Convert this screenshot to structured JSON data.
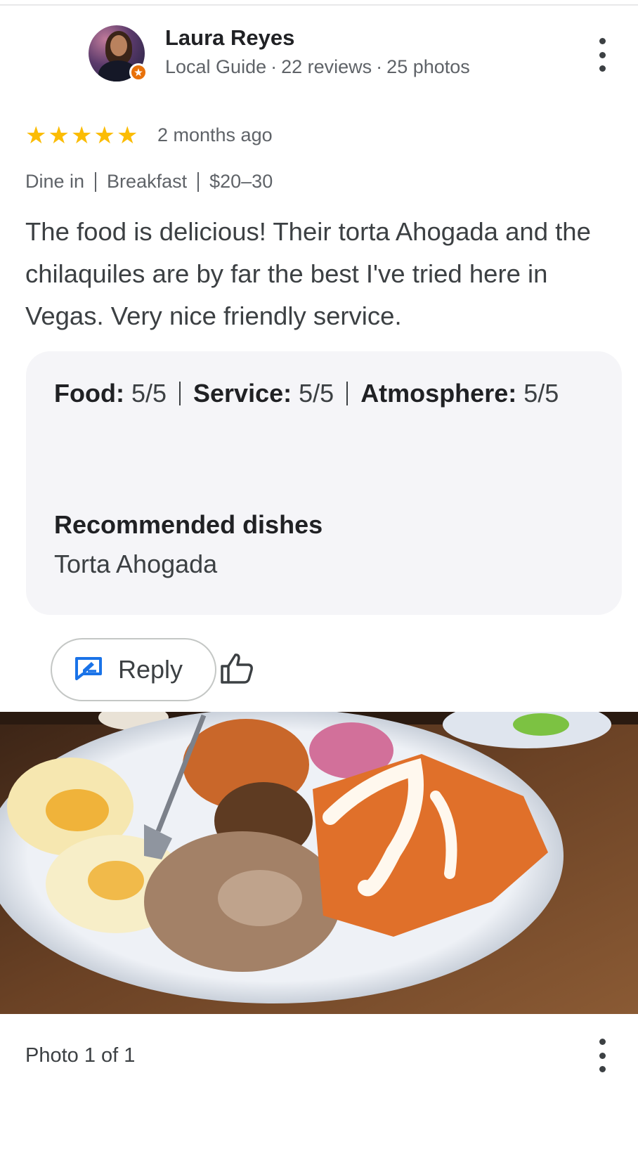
{
  "reviewer": {
    "name": "Laura Reyes",
    "badge": "Local Guide",
    "reviews": "22 reviews",
    "photos": "25 photos",
    "separator": "·"
  },
  "review": {
    "stars": 5,
    "star_glyph": "★",
    "star_color": "#fbbc04",
    "time": "2 months ago",
    "tags": [
      "Dine in",
      "Breakfast",
      "$20–30"
    ],
    "text": "The food is delicious! Their torta Ahogada and the chilaquiles are by far the best I've tried here in Vegas. Very nice friendly service."
  },
  "attributes": {
    "ratings": [
      {
        "label": "Food:",
        "value": "5/5"
      },
      {
        "label": "Service:",
        "value": "5/5"
      },
      {
        "label": "Atmosphere:",
        "value": "5/5"
      }
    ],
    "recommended_title": "Recommended dishes",
    "recommended_dish": "Torta Ahogada"
  },
  "actions": {
    "reply_label": "Reply",
    "reply_icon": "reply-edit-icon",
    "like_icon": "thumbs-up-icon",
    "more_icon": "more-vert-icon"
  },
  "photo": {
    "counter": "Photo 1 of 1"
  },
  "colors": {
    "accent_blue": "#1a73e8",
    "badge_orange": "#e8710a",
    "card_bg": "#f5f5f8"
  }
}
